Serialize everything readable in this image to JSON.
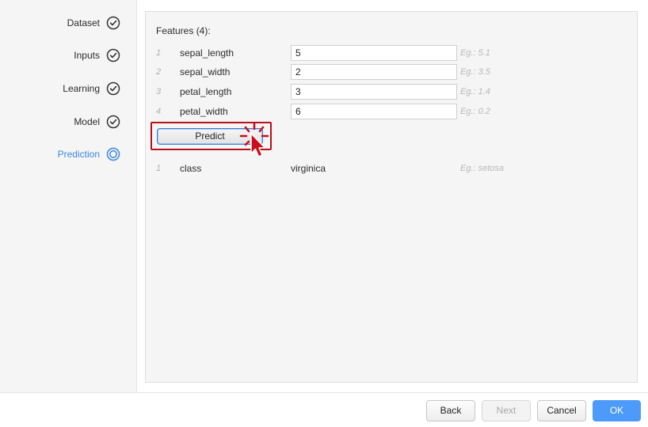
{
  "wizard": {
    "steps": [
      {
        "label": "Dataset",
        "state": "done"
      },
      {
        "label": "Inputs",
        "state": "done"
      },
      {
        "label": "Learning",
        "state": "done"
      },
      {
        "label": "Model",
        "state": "done"
      },
      {
        "label": "Prediction",
        "state": "active"
      }
    ]
  },
  "features": {
    "title": "Features (4):",
    "rows": [
      {
        "num": "1",
        "name": "sepal_length",
        "value": "5",
        "hint": "Eg.: 5.1"
      },
      {
        "num": "2",
        "name": "sepal_width",
        "value": "2",
        "hint": "Eg.: 3.5"
      },
      {
        "num": "3",
        "name": "petal_length",
        "value": "3",
        "hint": "Eg.: 1.4"
      },
      {
        "num": "4",
        "name": "petal_width",
        "value": "6",
        "hint": "Eg.: 0.2"
      }
    ]
  },
  "predict_button": {
    "label": "Predict"
  },
  "output": {
    "rows": [
      {
        "num": "1",
        "name": "class",
        "value": "virginica",
        "hint": "Eg.: setosa"
      }
    ]
  },
  "footer": {
    "back": "Back",
    "next": "Next",
    "cancel": "Cancel",
    "ok": "OK"
  },
  "colors": {
    "accent": "#3a86e0",
    "primary_button": "#4c9bfa",
    "highlight": "#b5121b"
  }
}
